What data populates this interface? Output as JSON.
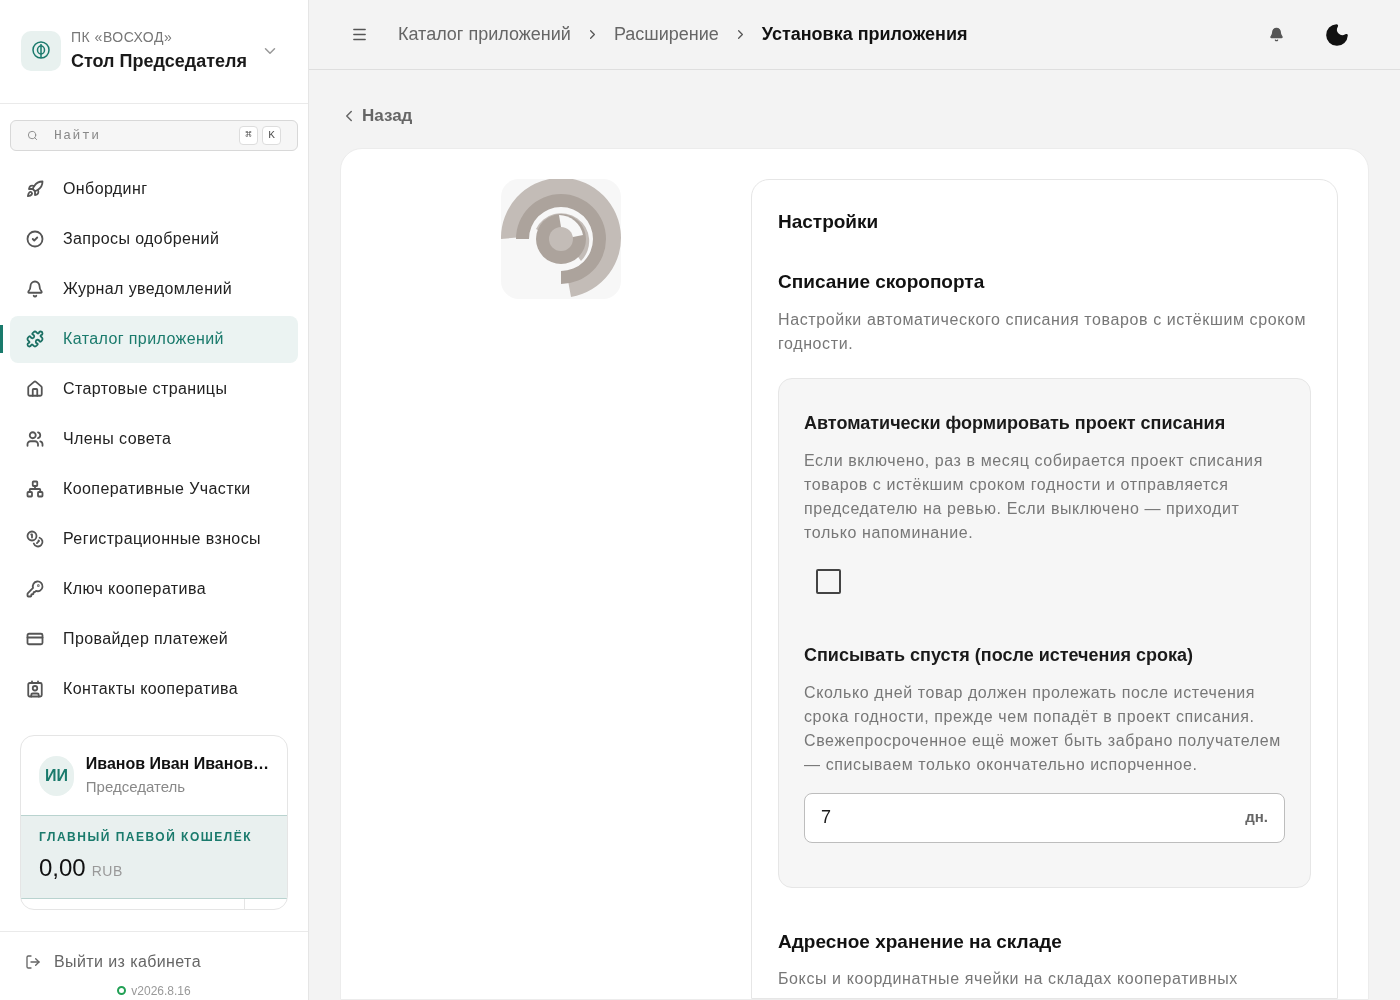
{
  "org": {
    "subtitle": "ПК «ВОСХОД»",
    "title": "Стол Председателя"
  },
  "search": {
    "placeholder": "Найти",
    "keys": [
      "⌘",
      "K"
    ]
  },
  "sidebar": {
    "items": [
      {
        "label": "Онбординг",
        "selected": false
      },
      {
        "label": "Запросы одобрений",
        "selected": false
      },
      {
        "label": "Журнал уведомлений",
        "selected": false
      },
      {
        "label": "Каталог приложений",
        "selected": true
      },
      {
        "label": "Стартовые страницы",
        "selected": false
      },
      {
        "label": "Члены совета",
        "selected": false
      },
      {
        "label": "Кооперативные Участки",
        "selected": false
      },
      {
        "label": "Регистрационные взносы",
        "selected": false
      },
      {
        "label": "Ключ кооператива",
        "selected": false
      },
      {
        "label": "Провайдер платежей",
        "selected": false
      },
      {
        "label": "Контакты кооператива",
        "selected": false
      }
    ]
  },
  "user": {
    "initials": "ИИ",
    "name": "Иванов Иван Иванов…",
    "role": "Председатель",
    "wallet_label": "ГЛАВНЫЙ ПАЕВОЙ КОШЕЛЁК",
    "balance": "0,00",
    "currency": "RUB"
  },
  "logout": "Выйти из кабинета",
  "version": "v2026.8.16",
  "breadcrumbs": [
    "Каталог приложений",
    "Расширение",
    "Установка приложения"
  ],
  "back": "Назад",
  "settings": {
    "title": "Настройки",
    "sections": [
      {
        "title": "Списание скоропорта",
        "description": "Настройки автоматического списания товаров с истёкшим сроком годности.",
        "fields": [
          {
            "kind": "checkbox",
            "label": "Автоматически формировать проект списания",
            "description": "Если включено, раз в месяц собирается проект списания товаров с истёкшим сроком годности и отправляется председателю на ревью. Если выключено — приходит только напоминание.",
            "checked": false
          },
          {
            "kind": "number",
            "label": "Списывать спустя (после истечения срока)",
            "description": "Сколько дней товар должен пролежать после истечения срока годности, прежде чем попадёт в проект списания. Свежепросроченное ещё может быть забрано получателем — списываем только окончательно испорченное.",
            "value": "7",
            "suffix": "дн."
          }
        ]
      },
      {
        "title": "Адресное хранение на складе",
        "description": "Боксы и координатные ячейки на складах кооперативных"
      }
    ]
  }
}
